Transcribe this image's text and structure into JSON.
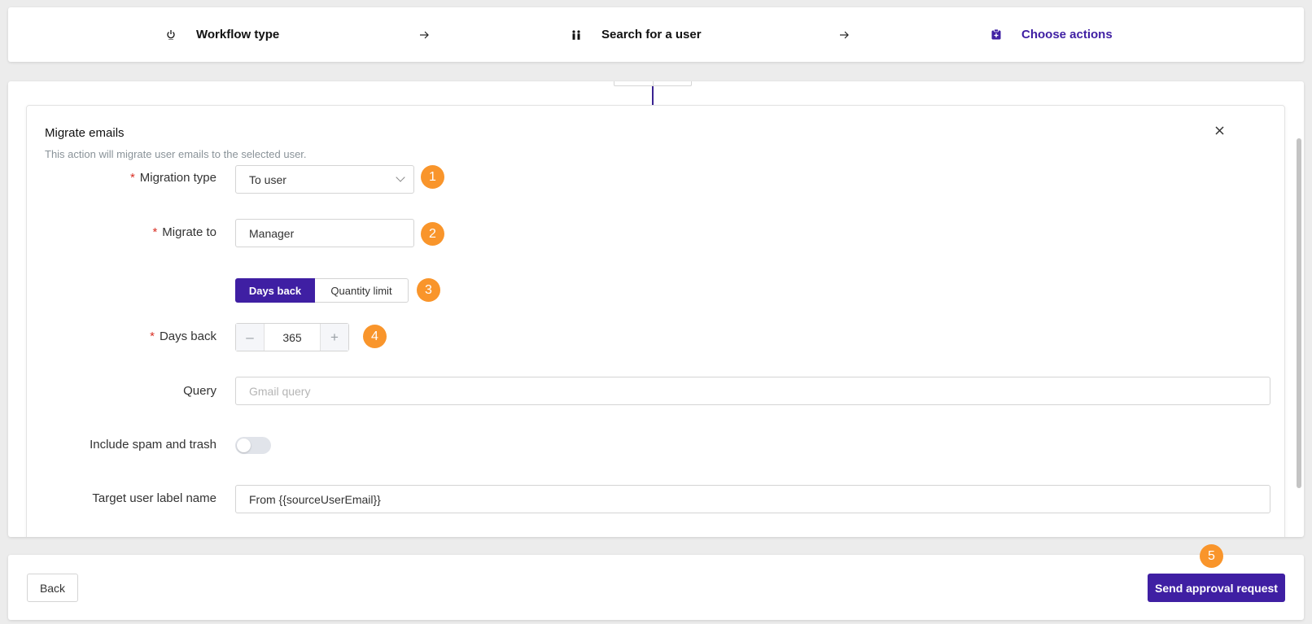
{
  "stepper": {
    "steps": [
      {
        "label": "Workflow type",
        "icon": "power-icon",
        "state": "completed"
      },
      {
        "label": "Search for a user",
        "icon": "users-icon",
        "state": "completed"
      },
      {
        "label": "Choose actions",
        "icon": "clipboard-icon",
        "state": "active"
      }
    ],
    "separator_icon": "arrow-right-icon",
    "active_color": "#3f1fa3"
  },
  "action_card": {
    "title": "Migrate emails",
    "description": "This action will migrate user emails to the selected user.",
    "close_icon": "close-icon",
    "required_mark": "*",
    "fields": {
      "migration_type": {
        "label": "Migration type",
        "required": true,
        "value": "To user"
      },
      "migrate_to": {
        "label": "Migrate to",
        "required": true,
        "value": "Manager"
      },
      "limit_mode": {
        "options": [
          "Days back",
          "Quantity limit"
        ],
        "selected": "Days back"
      },
      "days_back": {
        "label": "Days back",
        "required": true,
        "value": "365",
        "decrement": "–",
        "increment": "+"
      },
      "query": {
        "label": "Query",
        "value": "",
        "placeholder": "Gmail query"
      },
      "include_spam": {
        "label": "Include spam and trash",
        "value": false
      },
      "target_label": {
        "label": "Target user label name",
        "value": "From {{sourceUserEmail}}"
      }
    }
  },
  "badges": [
    "1",
    "2",
    "3",
    "4",
    "5"
  ],
  "footer": {
    "back_label": "Back",
    "send_label": "Send approval request"
  },
  "colors": {
    "primary": "#3f1fa3",
    "badge": "#f9952b",
    "required": "#d93025"
  }
}
